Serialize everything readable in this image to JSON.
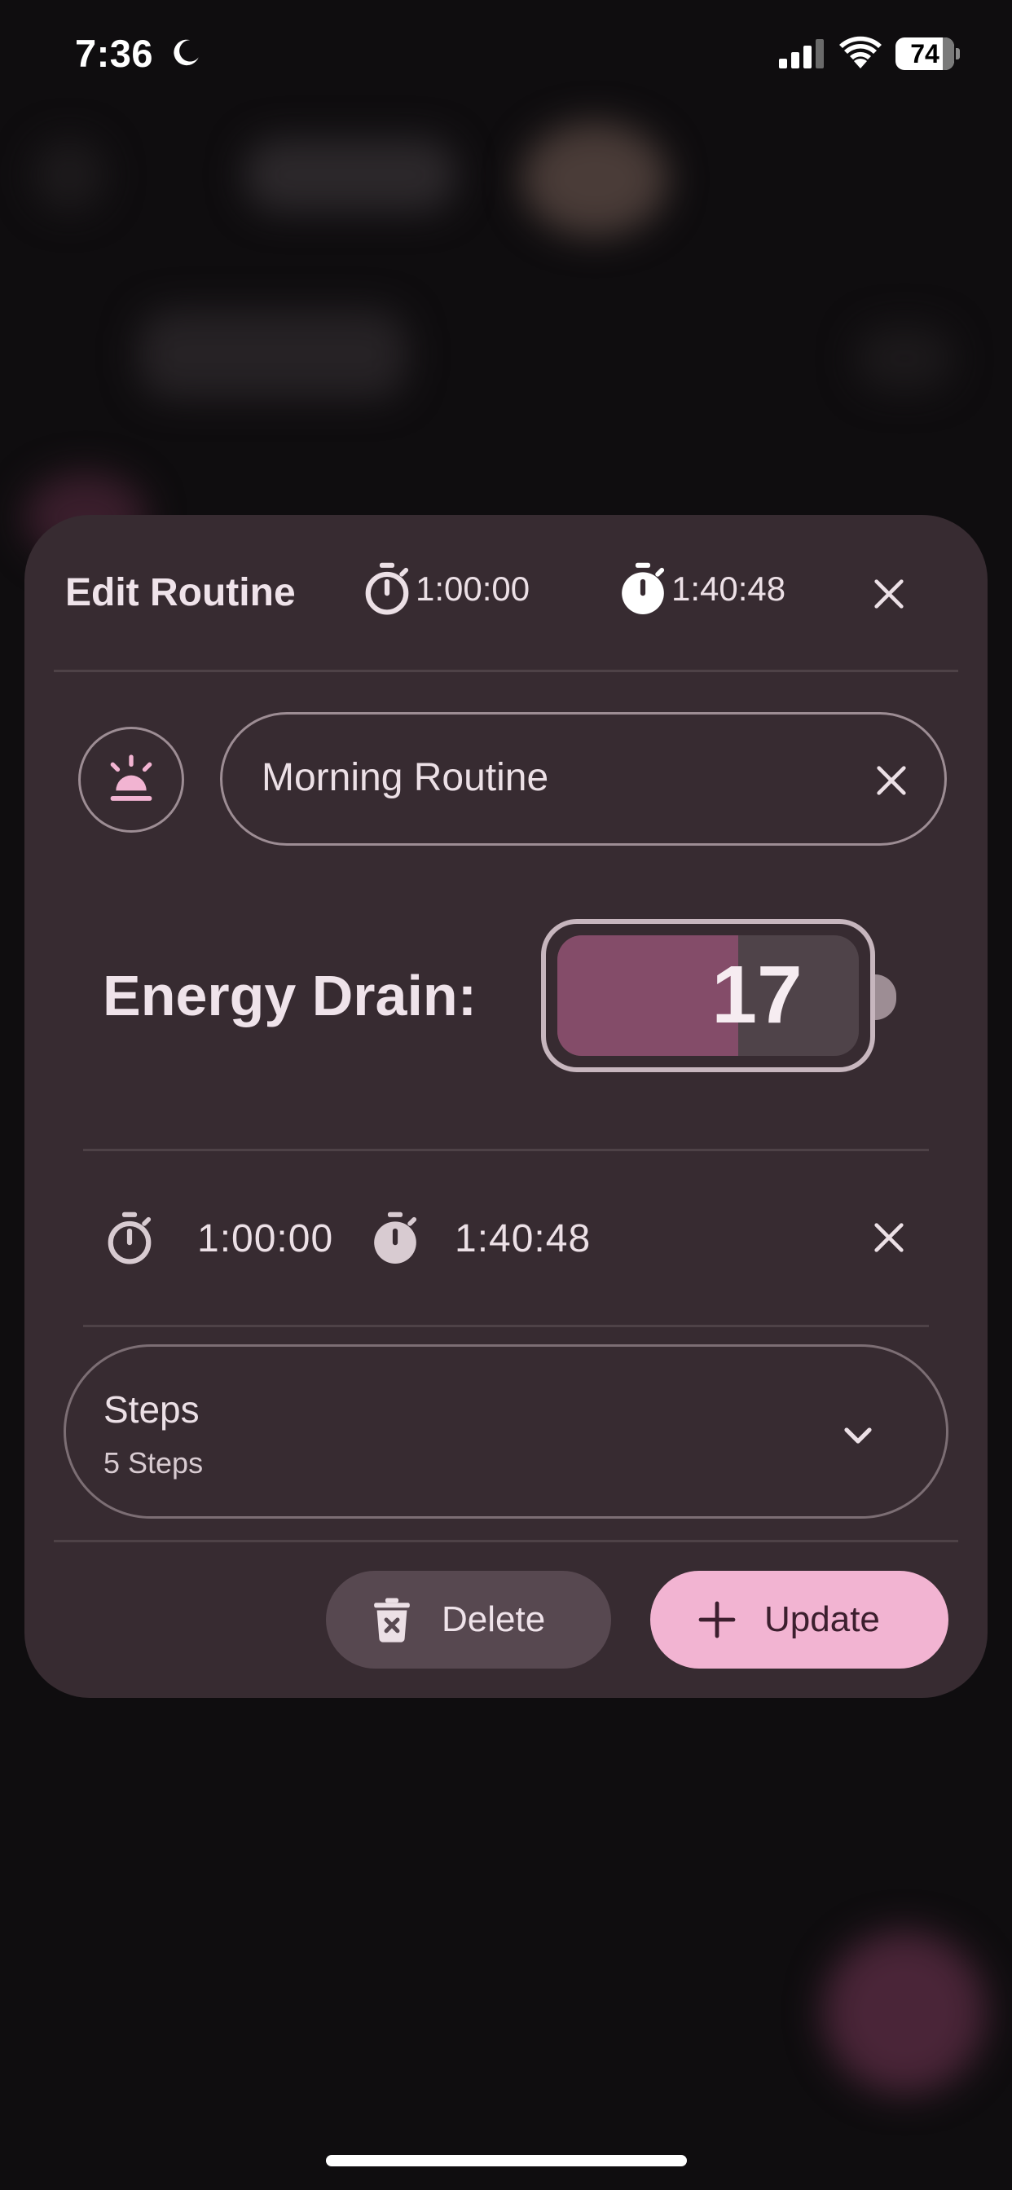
{
  "status_bar": {
    "time": "7:36",
    "battery_percent": "74",
    "battery_level": 0.74,
    "icons": [
      "moon-icon",
      "signal-icon",
      "wifi-icon",
      "battery-icon"
    ]
  },
  "dialog": {
    "title": "Edit Routine",
    "header_timers": [
      {
        "icon": "stopwatch-outline-icon",
        "value": "1:00:00"
      },
      {
        "icon": "stopwatch-filled-icon",
        "value": "1:40:48"
      }
    ],
    "routine_icon": "sunrise-alarm-icon",
    "name_field": {
      "value": "Morning Routine"
    },
    "energy": {
      "label": "Energy Drain:",
      "value": "17",
      "level": 0.6,
      "fill_color": "#844c69"
    },
    "time_row": {
      "start": "1:00:00",
      "end": "1:40:48"
    },
    "steps": {
      "title": "Steps",
      "subtitle": "5 Steps"
    },
    "buttons": {
      "delete_label": "Delete",
      "update_label": "Update"
    }
  },
  "colors": {
    "background": "#0f0d0f",
    "dialog": "#372b31",
    "accent": "#f2b4d2",
    "delete_button": "#574850"
  }
}
